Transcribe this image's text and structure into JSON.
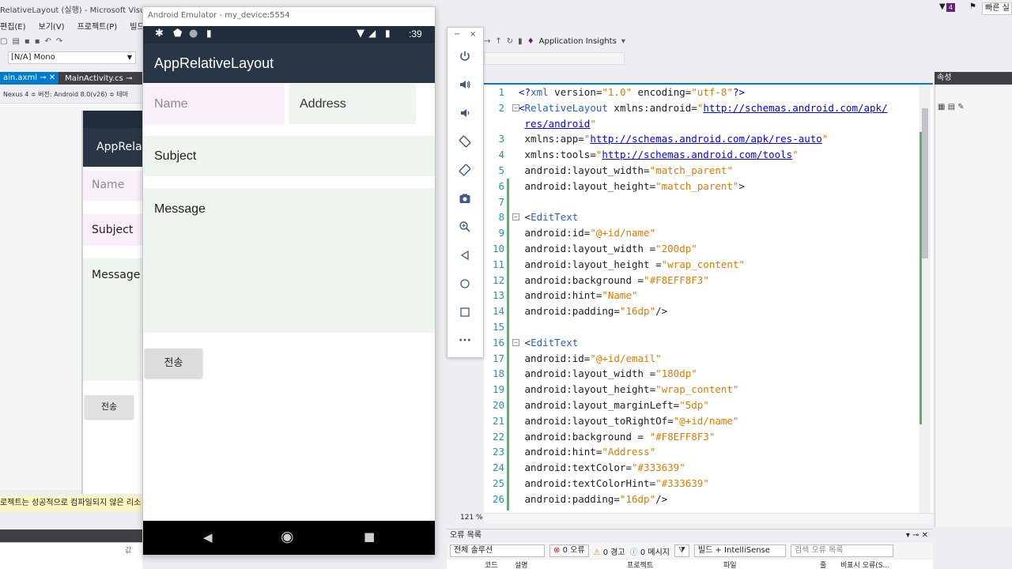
{
  "vs": {
    "window_title": "RelativeLayout (실행) - Microsoft Visual S",
    "menu": [
      "편집(E)",
      "보기(V)",
      "프로젝트(P)",
      "빌드"
    ],
    "mono_select": "[N/A] Mono",
    "tabs": {
      "axml": "ain.axml",
      "main_activity": "MainActivity.cs"
    },
    "device_bar": "Nexus 4 ≑  버전: Android 8.0(v26) ≑  테마",
    "quick_launch": "빠른 실",
    "toolbar_app_insights": "Application Insights",
    "props_title": "속성",
    "zoom": "121 %",
    "warning_text": "로젝트는 성공적으로 컴파일되지 않은 리소",
    "bottom_left_label": "값"
  },
  "designer": {
    "app_title": "AppRela",
    "name_hint": "Name",
    "subject": "Subject",
    "message": "Message",
    "send": "전송"
  },
  "emulator": {
    "window_title": "Android Emulator - my_device:5554",
    "time": ":39",
    "app_title": "AppRelativeLayout",
    "name_hint": "Name",
    "address_hint": "Address",
    "subject": "Subject",
    "message": "Message",
    "send_button": "전송"
  },
  "emulator_toolbar": {
    "minimize": "−",
    "close": "×",
    "more": "···"
  },
  "code": {
    "lines": [
      {
        "n": "1",
        "fold": "",
        "html_parts": [
          [
            "c-punct",
            "<?"
          ],
          [
            "c-el",
            "xml"
          ],
          [
            "c-plain",
            " version="
          ],
          [
            "c-str",
            "\"1.0\""
          ],
          [
            "c-plain",
            " encoding="
          ],
          [
            "c-str",
            "\"utf-8\""
          ],
          [
            "c-punct",
            "?>"
          ]
        ]
      },
      {
        "n": "2",
        "fold": "⊟",
        "html_parts": [
          [
            "c-punct",
            "<"
          ],
          [
            "c-el",
            "RelativeLayout"
          ],
          [
            "c-plain",
            " xmlns:android="
          ],
          [
            "c-str",
            "\""
          ],
          [
            "c-url",
            "http://schemas.android.com/apk/"
          ]
        ]
      },
      {
        "n": "",
        "fold": "",
        "html_parts": [
          [
            "c-plain",
            "  "
          ],
          [
            "c-url",
            "res/android"
          ],
          [
            "c-str",
            "\""
          ]
        ]
      },
      {
        "n": "3",
        "fold": "",
        "html_parts": [
          [
            "c-plain",
            "    xmlns:app="
          ],
          [
            "c-str",
            "\""
          ],
          [
            "c-url",
            "http://schemas.android.com/apk/res-auto"
          ],
          [
            "c-str",
            "\""
          ]
        ]
      },
      {
        "n": "4",
        "fold": "",
        "html_parts": [
          [
            "c-plain",
            "    xmlns:tools="
          ],
          [
            "c-str",
            "\""
          ],
          [
            "c-url",
            "http://schemas.android.com/tools"
          ],
          [
            "c-str",
            "\""
          ]
        ]
      },
      {
        "n": "5",
        "fold": "",
        "html_parts": [
          [
            "c-plain",
            "    android:layout_width="
          ],
          [
            "c-str",
            "\"match_parent\""
          ]
        ]
      },
      {
        "n": "6",
        "fold": "",
        "html_parts": [
          [
            "c-plain",
            "    android:layout_height="
          ],
          [
            "c-str",
            "\"match_parent\""
          ],
          [
            "c-plain",
            ">"
          ]
        ]
      },
      {
        "n": "7",
        "fold": "",
        "html_parts": []
      },
      {
        "n": "8",
        "fold": "⊟",
        "html_parts": [
          [
            "c-plain",
            "    <"
          ],
          [
            "c-el",
            "EditText"
          ]
        ]
      },
      {
        "n": "9",
        "fold": "",
        "html_parts": [
          [
            "c-plain",
            "        android:id="
          ],
          [
            "c-str",
            "\"@+id/name\""
          ]
        ]
      },
      {
        "n": "10",
        "fold": "",
        "html_parts": [
          [
            "c-plain",
            "        android:layout_width ="
          ],
          [
            "c-str",
            "\"200dp\""
          ]
        ]
      },
      {
        "n": "11",
        "fold": "",
        "html_parts": [
          [
            "c-plain",
            "        android:layout_height ="
          ],
          [
            "c-str",
            "\"wrap_content\""
          ]
        ]
      },
      {
        "n": "12",
        "fold": "",
        "html_parts": [
          [
            "c-plain",
            "        android:background ="
          ],
          [
            "c-str",
            "\"#F8EFF8F3\""
          ]
        ]
      },
      {
        "n": "13",
        "fold": "",
        "html_parts": [
          [
            "c-plain",
            "        android:hint="
          ],
          [
            "c-str",
            "\"Name\""
          ]
        ]
      },
      {
        "n": "14",
        "fold": "",
        "html_parts": [
          [
            "c-plain",
            "        android:padding="
          ],
          [
            "c-str",
            "\"16dp\""
          ],
          [
            "c-plain",
            "/>"
          ]
        ]
      },
      {
        "n": "15",
        "fold": "",
        "html_parts": []
      },
      {
        "n": "16",
        "fold": "⊟",
        "html_parts": [
          [
            "c-plain",
            "    <"
          ],
          [
            "c-el",
            "EditText"
          ]
        ]
      },
      {
        "n": "17",
        "fold": "",
        "html_parts": [
          [
            "c-plain",
            "        android:id="
          ],
          [
            "c-str",
            "\"@+id/email\""
          ]
        ]
      },
      {
        "n": "18",
        "fold": "",
        "html_parts": [
          [
            "c-plain",
            "        android:layout_width ="
          ],
          [
            "c-str",
            "\"180dp\""
          ]
        ]
      },
      {
        "n": "19",
        "fold": "",
        "html_parts": [
          [
            "c-plain",
            "        android:layout_height="
          ],
          [
            "c-str",
            "\"wrap_content\""
          ]
        ]
      },
      {
        "n": "20",
        "fold": "",
        "html_parts": [
          [
            "c-plain",
            "        android:layout_marginLeft="
          ],
          [
            "c-str",
            "\"5dp\""
          ]
        ]
      },
      {
        "n": "21",
        "fold": "",
        "html_parts": [
          [
            "c-plain",
            "        android:layout_toRightOf="
          ],
          [
            "c-str",
            "\"@+id/name\""
          ]
        ]
      },
      {
        "n": "22",
        "fold": "",
        "html_parts": [
          [
            "c-plain",
            "        android:background = "
          ],
          [
            "c-str",
            "\"#F8EFF8F3\""
          ]
        ]
      },
      {
        "n": "23",
        "fold": "",
        "html_parts": [
          [
            "c-plain",
            "        android:hint="
          ],
          [
            "c-str",
            "\"Address\""
          ]
        ]
      },
      {
        "n": "24",
        "fold": "",
        "html_parts": [
          [
            "c-plain",
            "        android:textColor="
          ],
          [
            "c-str",
            "\"#333639\""
          ]
        ]
      },
      {
        "n": "25",
        "fold": "",
        "html_parts": [
          [
            "c-plain",
            "        android:textColorHint="
          ],
          [
            "c-str",
            "\"#333639\""
          ]
        ]
      },
      {
        "n": "26",
        "fold": "",
        "html_parts": [
          [
            "c-plain",
            "        android:padding="
          ],
          [
            "c-str",
            "\"16dp\""
          ],
          [
            "c-plain",
            "/>"
          ]
        ]
      }
    ]
  },
  "error_list": {
    "title": "오류 목록",
    "scope": "전체 솔루션",
    "errors": "0 오류",
    "warnings": "0 경고",
    "messages": "0 메시지",
    "build_filter": "빌드 + IntelliSense",
    "search_placeholder": "검색 오류 목록",
    "columns": [
      "코드",
      "설명",
      "프로젝트",
      "파일",
      "줄",
      "비표시 오류(S..."
    ]
  },
  "colors": {
    "app_bar": "#283646",
    "status_bar": "#1f2d3d",
    "field_bg": "#F8EFF8",
    "vs_accent": "#007acc"
  }
}
